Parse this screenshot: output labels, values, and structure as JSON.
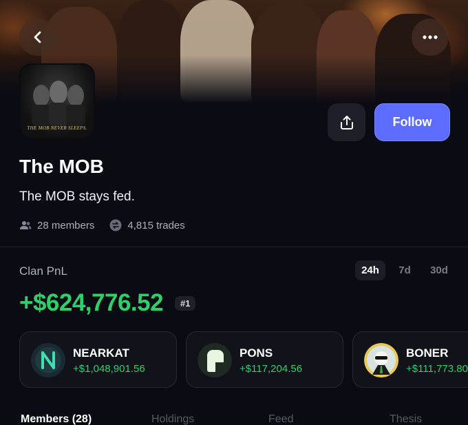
{
  "header": {
    "back_icon": "chevron-left-icon",
    "more_icon": "more-horizontal-icon"
  },
  "clan": {
    "avatar_tagline": "THE MOB NEVER SLEEPS.",
    "name": "The MOB",
    "description": "The MOB stays fed.",
    "members": "28 members",
    "trades": "4,815 trades"
  },
  "actions": {
    "share_icon": "share-icon",
    "follow_label": "Follow"
  },
  "pnl": {
    "label": "Clan PnL",
    "periods": [
      "24h",
      "7d",
      "30d"
    ],
    "selected_period": "24h",
    "value": "+$624,776.52",
    "rank": "#1"
  },
  "top_tokens": [
    {
      "name": "NEARKAT",
      "value": "+$1,048,901.56"
    },
    {
      "name": "PONS",
      "value": "+$117,204.56"
    },
    {
      "name": "BONER",
      "value": "+$111,773.80"
    }
  ],
  "tabs": [
    "Members (28)",
    "Holdings",
    "Feed",
    "Thesis"
  ],
  "colors": {
    "accent": "#5b6cff",
    "positive": "#2fd06a",
    "background": "#0b0b13"
  }
}
